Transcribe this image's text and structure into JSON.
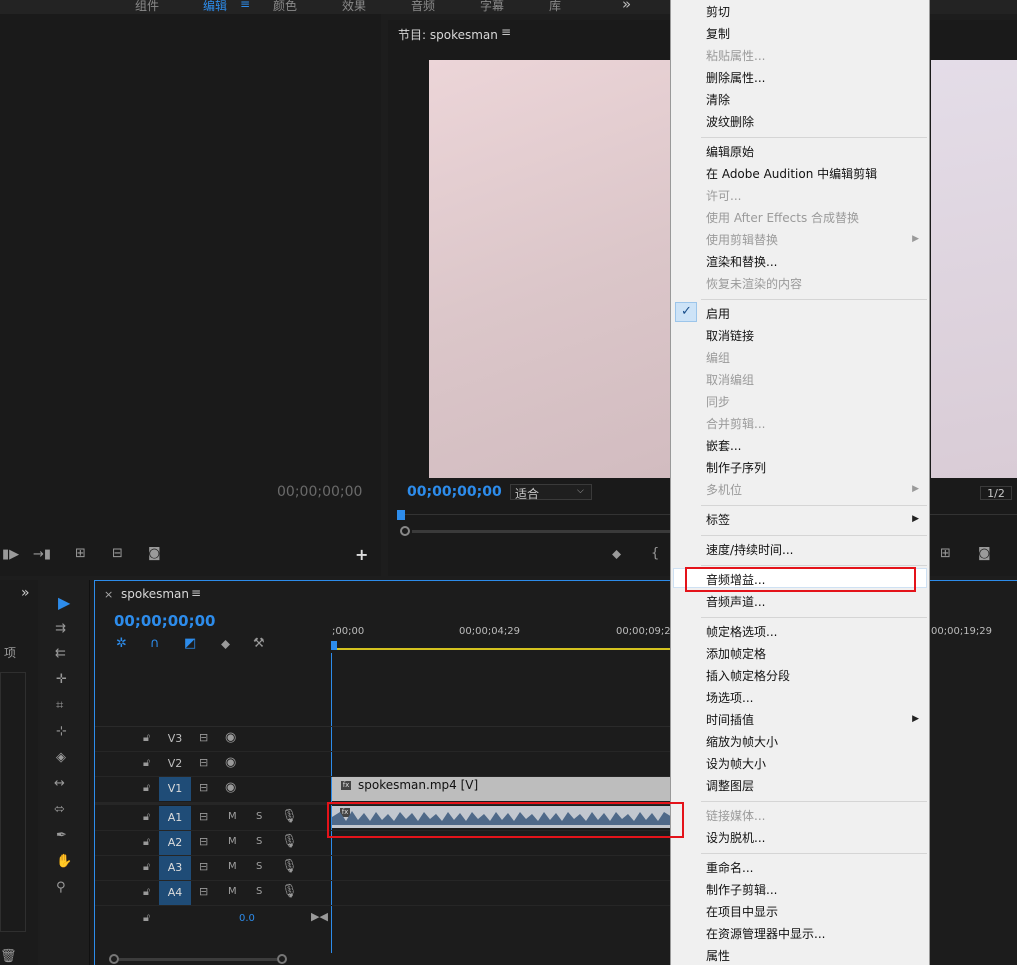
{
  "workspace_tabs": [
    "组件",
    "编辑",
    "颜色",
    "效果",
    "音频",
    "字幕",
    "库"
  ],
  "workspace_active_index": 1,
  "workspace_menu_icon": "≡",
  "workspace_more_icon": "»",
  "source": {
    "timecode": "00;00;00;00"
  },
  "program": {
    "title": "节目: spokesman",
    "menu_icon": "≡",
    "timecode": "00;00;00;00",
    "fit_label": "适合",
    "resolution": "1/2"
  },
  "timeline": {
    "close_icon": "×",
    "sequence_name": "spokesman",
    "menu_icon": "≡",
    "timecode": "00;00;00;00",
    "ruler_labels": [
      ";00;00",
      "00;00;04;29",
      "00;00;09;2",
      "00;00;19;29"
    ],
    "tracks": [
      {
        "name": "V3",
        "type": "video",
        "on": false
      },
      {
        "name": "V2",
        "type": "video",
        "on": false
      },
      {
        "name": "V1",
        "type": "video",
        "on": true
      },
      {
        "name": "A1",
        "type": "audio",
        "on": true
      },
      {
        "name": "A2",
        "type": "audio",
        "on": true
      },
      {
        "name": "A3",
        "type": "audio",
        "on": true
      },
      {
        "name": "A4",
        "type": "audio",
        "on": true
      }
    ],
    "mute_label": "M",
    "solo_label": "S",
    "master_volume": "0.0",
    "video_clip_name": "spokesman.mp4 [V]",
    "fx_label": "fx"
  },
  "left_panel": {
    "label": "项"
  },
  "context_menu": {
    "check_mark": "✓",
    "submenu_arrow": "▶",
    "items": [
      {
        "label": "剪切",
        "disabled": false
      },
      {
        "label": "复制",
        "disabled": false
      },
      {
        "label": "粘贴属性...",
        "disabled": true
      },
      {
        "label": "删除属性...",
        "disabled": false
      },
      {
        "label": "清除",
        "disabled": false
      },
      {
        "label": "波纹删除",
        "disabled": false
      },
      {
        "label": "编辑原始",
        "disabled": false
      },
      {
        "label": "在 Adobe Audition 中编辑剪辑",
        "disabled": false
      },
      {
        "label": "许可...",
        "disabled": true
      },
      {
        "label": "使用 After Effects 合成替换",
        "disabled": true
      },
      {
        "label": "使用剪辑替换",
        "disabled": true
      },
      {
        "label": "渲染和替换...",
        "disabled": false
      },
      {
        "label": "恢复未渲染的内容",
        "disabled": true
      },
      {
        "label": "启用",
        "disabled": false,
        "checked": true
      },
      {
        "label": "取消链接",
        "disabled": false
      },
      {
        "label": "编组",
        "disabled": true
      },
      {
        "label": "取消编组",
        "disabled": true
      },
      {
        "label": "同步",
        "disabled": true
      },
      {
        "label": "合并剪辑...",
        "disabled": true
      },
      {
        "label": "嵌套...",
        "disabled": false
      },
      {
        "label": "制作子序列",
        "disabled": false
      },
      {
        "label": "多机位",
        "disabled": true
      },
      {
        "label": "标签",
        "disabled": false
      },
      {
        "label": "速度/持续时间...",
        "disabled": false
      },
      {
        "label": "音频增益...",
        "disabled": false,
        "highlighted": true
      },
      {
        "label": "音频声道...",
        "disabled": false
      },
      {
        "label": "帧定格选项...",
        "disabled": false
      },
      {
        "label": "添加帧定格",
        "disabled": false
      },
      {
        "label": "插入帧定格分段",
        "disabled": false
      },
      {
        "label": "场选项...",
        "disabled": false
      },
      {
        "label": "时间插值",
        "disabled": false
      },
      {
        "label": "缩放为帧大小",
        "disabled": false
      },
      {
        "label": "设为帧大小",
        "disabled": false
      },
      {
        "label": "调整图层",
        "disabled": false
      },
      {
        "label": "链接媒体...",
        "disabled": true
      },
      {
        "label": "设为脱机...",
        "disabled": false
      },
      {
        "label": "重命名...",
        "disabled": false
      },
      {
        "label": "制作子剪辑...",
        "disabled": false
      },
      {
        "label": "在项目中显示",
        "disabled": false
      },
      {
        "label": "在资源管理器中显示...",
        "disabled": false
      },
      {
        "label": "属性",
        "disabled": false
      }
    ]
  },
  "colors": {
    "accent_blue": "#2d8ceb",
    "highlight_red": "#e4131a",
    "menu_bg": "#f0f0f0"
  }
}
